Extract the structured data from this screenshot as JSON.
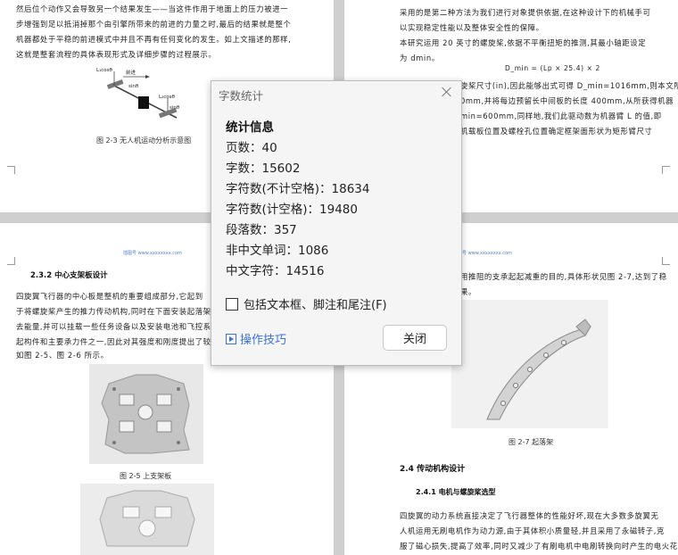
{
  "dialog": {
    "title": "字数统计",
    "heading": "统计信息",
    "stats": [
      "页数：40",
      "字数：15602",
      "字符数(不计空格)：18634",
      "字符数(计空格)：19480",
      "段落数：357",
      "非中文单词：1086",
      "中文字符：14516"
    ],
    "checkbox_label": "包括文本框、脚注和尾注(F)",
    "tips_label": "操作技巧",
    "close_label": "关闭"
  },
  "doc": {
    "tl_lines": [
      "然后位个动作又会导致另一个结果发生——当这件作用于地面上的压力被进一",
      "步增强到足以抵消掉那个由引擎所带来的前进的力量之时,最后的结果就是整个",
      "机器都处于平稳的前进模式中并且不再有任何变化的发生。如上文描述的那样,",
      "这就是整套流程的具体表现形式及详细步骤的过程展示。"
    ],
    "fig23_caption": "图 2-3  无人机运动分析示意图",
    "fig23_labels": {
      "l1": "L₁cosθ",
      "l2": "L₂cosθ",
      "dir": "前进",
      "s1": "sinθ",
      "s2": "sinθ"
    },
    "tr_lines": [
      "采用的是第二种方法为我们进行对象提供依据,在这种设计下的机械手可",
      "以实现稳定性能以及整体安全性的保障。",
      "    本研究运用 20 英寸的螺旋桨,依据不平衡扭矩的推测,其最小轴距设定",
      "为 dmin。"
    ],
    "tr_formula": "D_min = (Lp × 25.4) × 2",
    "tr_lines2": [
      "旋桨尺寸(in),因此能够出式可得 D_min=1016mm,则本文所",
      "0mm,并将每边预留长中间板的长度 400mm,从所获得机器",
      "min=600mm,同样地,我们此驱动数为机器臂 L 的值,即",
      "机载板位置及螺栓孔位置确定框架面形状为矩形臂尺寸"
    ],
    "bl_header": "插图号 www.xxxxxxxx.com",
    "bl_heading": "2.3.2  中心支架板设计",
    "bl_lines": [
      "    四旋翼飞行器的中心板是整机的重要组成部分,它起到",
      "于将螺旋桨产生的推力传动机构,同时在下面安装起落架以",
      "去能量,并可以挂载一些任务设备以及安装电池和飞控系统",
      "起构件和主要承力件之一,因此对其强度和刚度提出了较",
      "如图 2-5、图 2-6 所示。"
    ],
    "fig25_caption": "图 2-5  上支架板",
    "br_header": "插图号 www.xxxxxxxx.com",
    "br_lines": [
      "用推阻的支承起起减重的目的,具体形状见图 2-7,达到了稳",
      "果。"
    ],
    "fig27_caption": "图 2-7  起落架",
    "br_heading1": "2.4  传动机构设计",
    "br_heading2": "2.4.1  电机与螺旋桨选型",
    "br_lines2": [
      "    四旋翼的动力系统直接决定了飞行器整体的性能好坏,现在大多数多旋翼无",
      "人机运用无刷电机作为动力源,由于其体积小质量轻,并且采用了永磁转子,克",
      "服了磁心损失,提高了效率,同时又减少了有刷电机中电刷转换向时产生的电火花"
    ]
  }
}
